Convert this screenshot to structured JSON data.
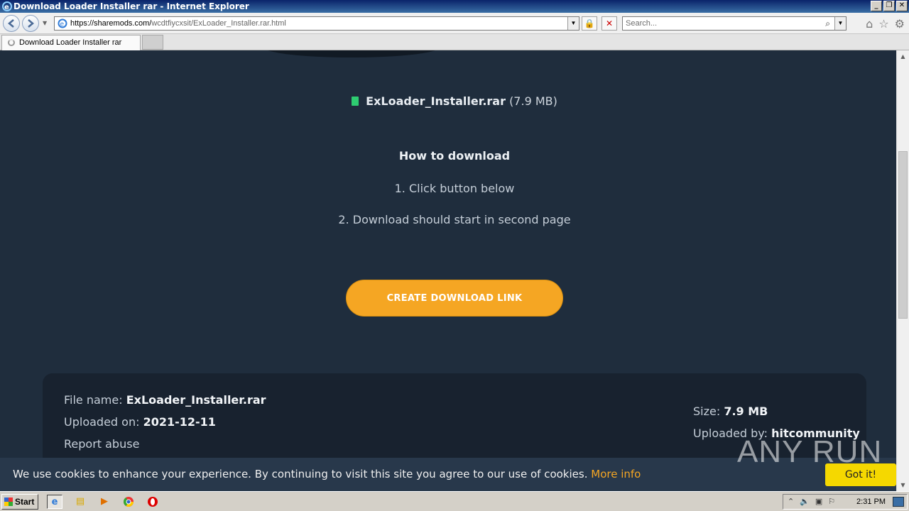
{
  "window": {
    "title": "Download Loader Installer rar - Internet Explorer",
    "controls": [
      "_",
      "❐",
      "✕"
    ]
  },
  "address_bar": {
    "url_host": "https://sharemods.com/",
    "url_path": "wcdtfiycxsit/ExLoader_Installer.rar.html"
  },
  "search": {
    "placeholder": "Search..."
  },
  "tabs": [
    {
      "label": "Download Loader Installer rar"
    }
  ],
  "page": {
    "file_name": "ExLoader_Installer.rar",
    "file_size_paren": "(7.9 MB)",
    "how_to_title": "How to download",
    "step1": "1. Click button below",
    "step2": "2. Download should start in second page",
    "cta_label": "CREATE DOWNLOAD LINK",
    "info": {
      "file_name_label": "File name:",
      "file_name_value": "ExLoader_Installer.rar",
      "uploaded_on_label": "Uploaded on:",
      "uploaded_on_value": "2021-12-11",
      "report_label": "Report abuse",
      "size_label": "Size:",
      "size_value": "7.9 MB",
      "uploaded_by_label": "Uploaded by:",
      "uploaded_by_value": "hitcommunity"
    }
  },
  "cookie": {
    "message": "We use cookies to enhance your experience. By continuing to visit this site you agree to our use of cookies.",
    "more_info": "More info",
    "accept": "Got it!"
  },
  "watermark": "ANY RUN",
  "taskbar": {
    "start_label": "Start",
    "clock": "2:31 PM"
  },
  "colors": {
    "page_bg": "#1f2d3d",
    "accent": "#f5a623",
    "file_icon": "#2ecc71",
    "cookie_button": "#f5d800"
  }
}
